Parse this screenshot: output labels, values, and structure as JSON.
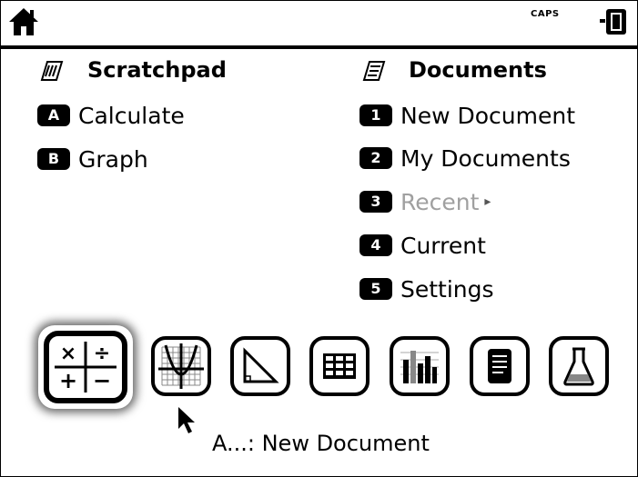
{
  "topbar": {
    "home_icon": "home-icon",
    "caps_label": "CAPS",
    "battery_icon": "battery-icon"
  },
  "scratchpad": {
    "title": "Scratchpad",
    "icon": "scratchpad-icon",
    "items": [
      {
        "key": "A",
        "label": "Calculate"
      },
      {
        "key": "B",
        "label": "Graph"
      }
    ]
  },
  "documents": {
    "title": "Documents",
    "icon": "documents-icon",
    "items": [
      {
        "key": "1",
        "label": "New Document",
        "enabled": true
      },
      {
        "key": "2",
        "label": "My Documents",
        "enabled": true
      },
      {
        "key": "3",
        "label": "Recent",
        "enabled": false,
        "submenu_arrow": "▸"
      },
      {
        "key": "4",
        "label": "Current",
        "enabled": true
      },
      {
        "key": "5",
        "label": "Settings",
        "enabled": true
      }
    ]
  },
  "app_bar": {
    "selected": "calculator",
    "apps": [
      "calculator-icon",
      "graph-icon",
      "geometry-icon",
      "table-icon",
      "data-stats-icon",
      "notes-icon",
      "lab-flask-icon"
    ]
  },
  "tooltip": {
    "text": "A...: New Document"
  }
}
